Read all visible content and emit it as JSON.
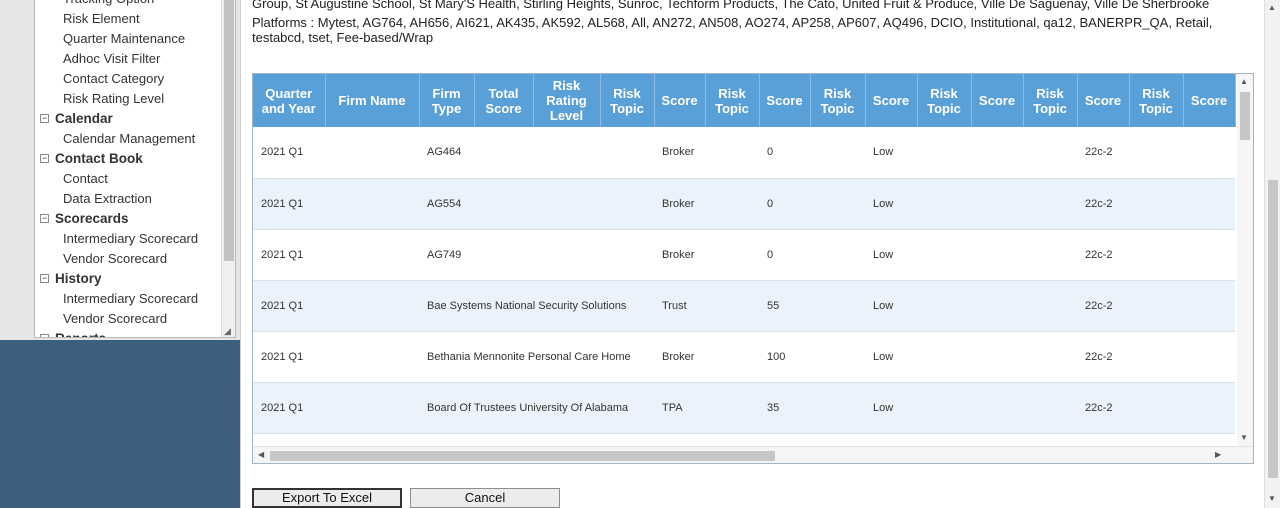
{
  "sidebar": {
    "items": [
      {
        "type": "child",
        "label": "Tracking Option"
      },
      {
        "type": "child",
        "label": "Risk Element"
      },
      {
        "type": "child",
        "label": "Quarter Maintenance"
      },
      {
        "type": "child",
        "label": "Adhoc Visit Filter"
      },
      {
        "type": "child",
        "label": "Contact Category"
      },
      {
        "type": "child",
        "label": "Risk Rating Level"
      },
      {
        "type": "group",
        "label": "Calendar",
        "toggle": "−"
      },
      {
        "type": "child",
        "label": "Calendar Management"
      },
      {
        "type": "group",
        "label": "Contact Book",
        "toggle": "−"
      },
      {
        "type": "child",
        "label": "Contact"
      },
      {
        "type": "child",
        "label": "Data Extraction"
      },
      {
        "type": "group",
        "label": "Scorecards",
        "toggle": "−"
      },
      {
        "type": "child",
        "label": "Intermediary Scorecard"
      },
      {
        "type": "child",
        "label": "Vendor Scorecard"
      },
      {
        "type": "group",
        "label": "History",
        "toggle": "−"
      },
      {
        "type": "child",
        "label": "Intermediary Scorecard"
      },
      {
        "type": "child",
        "label": "Vendor Scorecard"
      },
      {
        "type": "group",
        "label": "Reports",
        "toggle": "−"
      }
    ],
    "grip": "◢"
  },
  "info": {
    "firms_line": "Group, St Augustine School, St Mary'S Health, Stirling Heights, Sunroc, Techform Products, The Cato, United Fruit & Produce, Ville De Saguenay, Ville De Sherbrooke",
    "platforms_line": "Platforms : Mytest, AG764, AH656, AI621, AK435, AK592, AL568, All, AN272, AN508, AO274, AP258, AP607, AQ496, DCIO, Institutional, qa12, BANERPR_QA, Retail, testabcd, tset, Fee-based/Wrap"
  },
  "table": {
    "columns": [
      "Quarter and Year",
      "Firm Name",
      "Firm Type",
      "Total Score",
      "Risk Rating Level",
      "Risk Topic",
      "Score",
      "Risk Topic",
      "Score",
      "Risk Topic",
      "Score",
      "Risk Topic",
      "Score",
      "Risk Topic",
      "Score",
      "Risk Topic",
      "Score"
    ],
    "rows": [
      [
        "2021 Q1",
        "AG464",
        "Broker",
        "0",
        "Low",
        "22c-2"
      ],
      [
        "2021 Q1",
        "AG554",
        "Broker",
        "0",
        "Low",
        "22c-2"
      ],
      [
        "2021 Q1",
        "AG749",
        "Broker",
        "0",
        "Low",
        "22c-2"
      ],
      [
        "2021 Q1",
        "Bae Systems National Security Solutions",
        "Trust",
        "55",
        "Low",
        "22c-2"
      ],
      [
        "2021 Q1",
        "Bethania Mennonite Personal Care Home",
        "Broker",
        "100",
        "Low",
        "22c-2"
      ],
      [
        "2021 Q1",
        "Board Of Trustees University Of Alabama",
        "TPA",
        "35",
        "Low",
        "22c-2"
      ]
    ]
  },
  "scroll_glyphs": {
    "up": "▲",
    "down": "▼",
    "left": "◀",
    "right": "▶"
  },
  "buttons": {
    "export": "Export To Excel",
    "cancel": "Cancel"
  },
  "colors": {
    "header_bg": "#5aa0d8",
    "alt_row": "#eaf3fb",
    "sidebar_bg": "#3d5f7e"
  }
}
